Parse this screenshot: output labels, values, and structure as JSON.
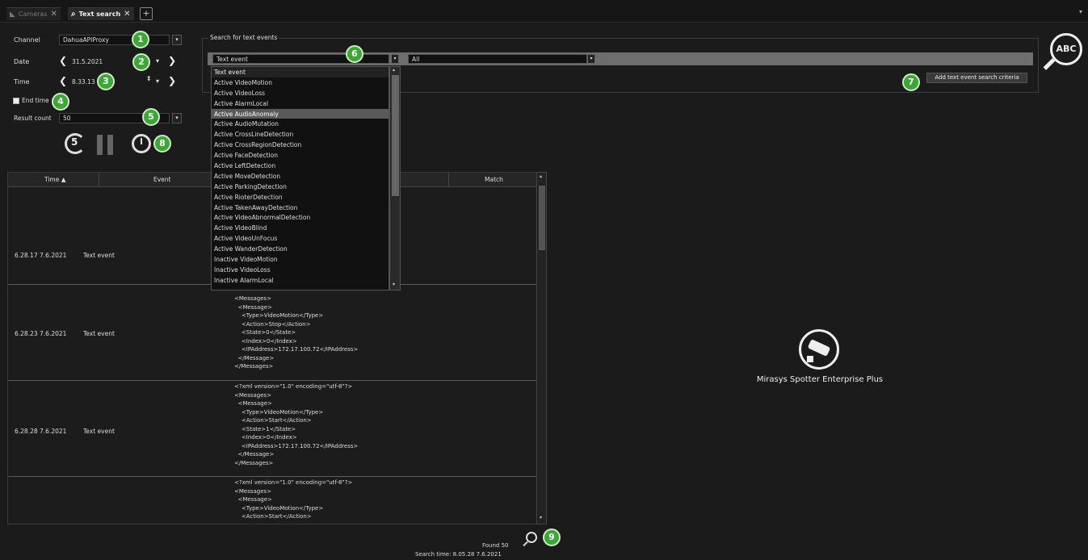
{
  "tabs": [
    {
      "label": "Cameras",
      "active": false
    },
    {
      "label": "Text search",
      "active": true
    }
  ],
  "form": {
    "channel_label": "Channel",
    "channel_value": "DahuaAPIProxy",
    "date_label": "Date",
    "date_value": "31.5.2021",
    "time_label": "Time",
    "time_value": "8.33.13",
    "end_time_label": "End time",
    "result_count_label": "Result count",
    "result_count_value": "50"
  },
  "search": {
    "legend": "Search for text events",
    "event_type_value": "Text event",
    "second_value": "All",
    "add_criteria_label": "Add text event search criteria"
  },
  "dropdown_items": [
    "Text event",
    "Active VideoMotion",
    "Active VideoLoss",
    "Active AlarmLocal",
    "Active AudioAnomaly",
    "Active AudioMutation",
    "Active CrossLineDetection",
    "Active CrossRegionDetection",
    "Active FaceDetection",
    "Active LeftDetection",
    "Active MoveDetection",
    "Active ParkingDetection",
    "Active RioterDetection",
    "Active TakenAwayDetection",
    "Active VideoAbnormalDetection",
    "Active VideoBlind",
    "Active VideoUnFocus",
    "Active WanderDetection",
    "Inactive VideoMotion",
    "Inactive VideoLoss",
    "Inactive AlarmLocal"
  ],
  "dropdown_selected_index": 4,
  "table": {
    "headers": [
      "Time ▲",
      "Event",
      "Match"
    ],
    "rows": [
      {
        "time": "6.28.17 7.6.2021",
        "event": "Text event",
        "xml": ""
      },
      {
        "time": "6.28.23 7.6.2021",
        "event": "Text event",
        "xml": "<Messages>\n  <Message>\n    <Type>VideoMotion</Type>\n    <Action>Stop</Action>\n    <State>0</State>\n    <Index>0</Index>\n    <IPAddress>172.17.100.72</IPAddress>\n  </Message>\n</Messages>"
      },
      {
        "time": "6.28.28 7.6.2021",
        "event": "Text event",
        "xml": "<?xml version=\"1.0\" encoding=\"utf-8\"?>\n<Messages>\n  <Message>\n    <Type>VideoMotion</Type>\n    <Action>Start</Action>\n    <State>1</State>\n    <Index>0</Index>\n    <IPAddress>172.17.100.72</IPAddress>\n  </Message>\n</Messages>"
      },
      {
        "time": "",
        "event": "",
        "xml": "<?xml version=\"1.0\" encoding=\"utf-8\"?>\n<Messages>\n  <Message>\n    <Type>VideoMotion</Type>\n    <Action>Start</Action>"
      }
    ]
  },
  "video_pane": {
    "product_name": "Mirasys Spotter Enterprise Plus"
  },
  "footer": {
    "found": "Found 50",
    "search_time": "Search time: 8.05.28 7.6.2021"
  },
  "badges": [
    "1",
    "2",
    "3",
    "4",
    "5",
    "6",
    "7",
    "8",
    "9"
  ],
  "icons": {
    "abc_search": "ABC",
    "replay_seconds": "5"
  },
  "colors": {
    "badge_green": "#3aa832",
    "background": "#1b1b1b"
  }
}
